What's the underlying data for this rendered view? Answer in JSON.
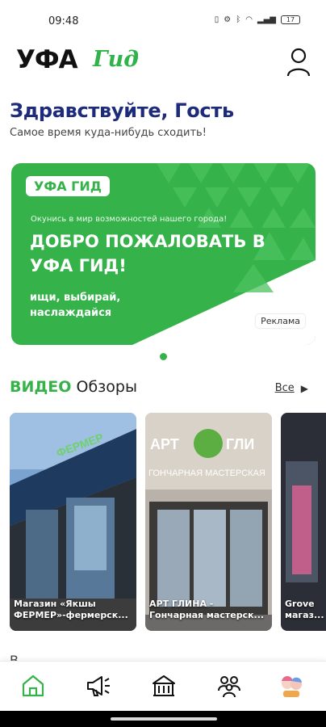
{
  "status_bar": {
    "time": "09:48",
    "battery": "17"
  },
  "header": {
    "logo_main": "УФА",
    "logo_sub": "Гид"
  },
  "greeting": {
    "title": "Здравствуйте,  Гость",
    "subtitle": "Самое время куда-нибудь сходить!"
  },
  "banner": {
    "badge": "УФА ГИД",
    "small_text": "Окунись в мир возможностей нашего города!",
    "title": "ДОБРО ПОЖАЛОВАТЬ В УФА ГИД!",
    "motto": "ищи, выбирай, наслаждайся",
    "ad_label": "Реклама",
    "colors": {
      "brand_green": "#35b24a"
    }
  },
  "videos": {
    "title_accent": "ВИДЕО",
    "title_rest": "Обзоры",
    "see_all": "Все",
    "cards": [
      {
        "caption": "Магазин «Якшы ФЕРМЕР»-фермерск..."
      },
      {
        "caption": "АРТ ГЛИНА - Гончарная мастерск..."
      },
      {
        "caption": "Grove магаз..."
      }
    ]
  },
  "next_section": {
    "title": "В"
  },
  "bottom_nav": {
    "items": [
      {
        "icon": "home-icon",
        "active": true
      },
      {
        "icon": "megaphone-icon",
        "active": false
      },
      {
        "icon": "building-icon",
        "active": false
      },
      {
        "icon": "people-icon",
        "active": false
      },
      {
        "icon": "kids-icon",
        "active": false
      }
    ]
  }
}
